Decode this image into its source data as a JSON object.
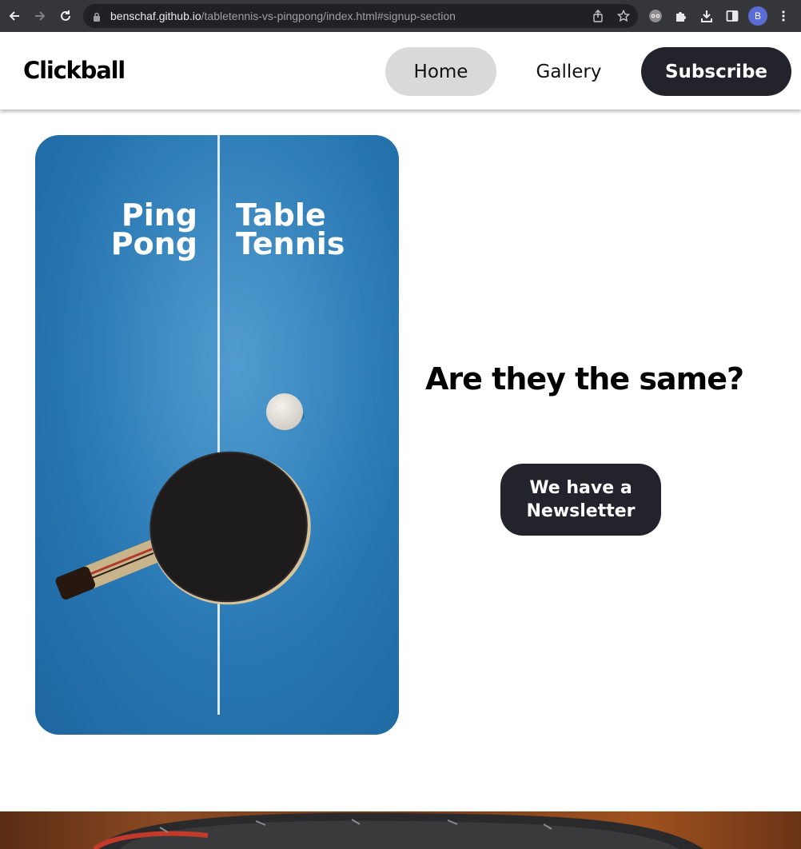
{
  "browser": {
    "url_host": "benschaf.github.io",
    "url_path": "/tabletennis-vs-pingpong/index.html#signup-section",
    "profile_initial": "B",
    "icons": [
      "back-icon",
      "forward-icon",
      "reload-icon",
      "lock-icon",
      "share-icon",
      "star-icon",
      "extension-mask-icon",
      "puzzle-icon",
      "download-icon",
      "sidebar-icon",
      "menu-dots-icon"
    ]
  },
  "header": {
    "logo": "Clickball",
    "nav": {
      "home": "Home",
      "gallery": "Gallery",
      "subscribe": "Subscribe"
    }
  },
  "hero": {
    "card_left_line1": "Ping",
    "card_left_line2": "Pong",
    "card_right_line1": "Table",
    "card_right_line2": "Tennis",
    "title": "Are they the same?",
    "newsletter_button": "We have a Newsletter"
  },
  "colors": {
    "chrome_bg": "#35363a",
    "omnibox_bg": "#202124",
    "dark_button": "#23232b",
    "active_nav": "#d9d9d9",
    "table_blue": "#2a7bb7"
  }
}
